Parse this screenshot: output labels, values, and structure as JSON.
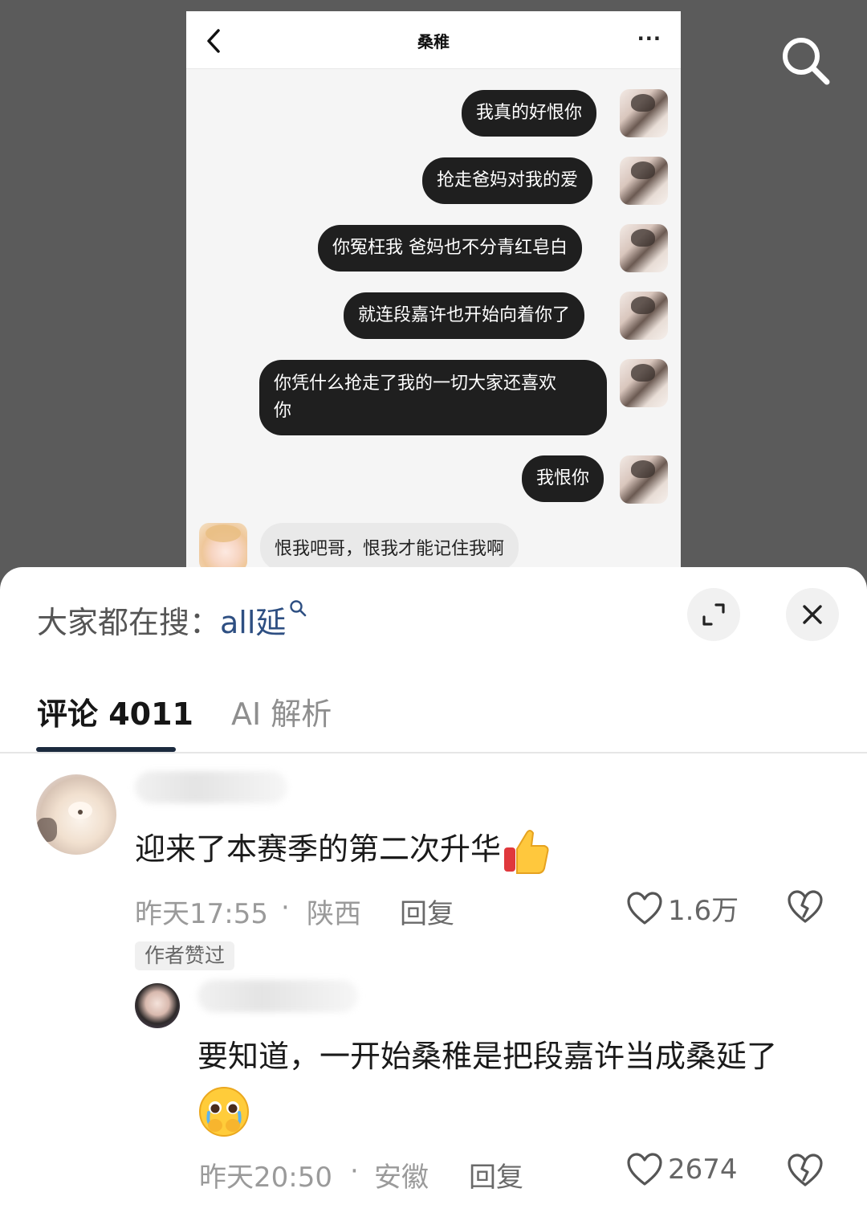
{
  "chat": {
    "title": "桑稚",
    "more": "···",
    "messages_right": [
      "我真的好恨你",
      "抢走爸妈对我的爱",
      "你冤枉我 爸妈也不分青红皂白",
      "就连段嘉许也开始向着你了",
      "你凭什么抢走了我的一切大家还喜欢",
      "你",
      "我恨你"
    ],
    "message_left": "恨我吧哥，恨我才能记住我啊"
  },
  "hot_search": {
    "prefix": "大家都在搜：",
    "keyword": "all延"
  },
  "tabs": {
    "comments": "评论 4011",
    "ai": "AI 解析"
  },
  "comments": [
    {
      "text": "迎来了本赛季的第二次升华",
      "emoji": "thumbs-up-icon",
      "time": "昨天17:55",
      "location": "陕西",
      "reply": "回复",
      "likes": "1.6万",
      "badge": "作者赞过"
    },
    {
      "text_line1": "要知道，一开始桑稚是把段嘉许当成桑延了",
      "emoji": "pleading-face-icon",
      "time": "昨天20:50",
      "location": "安徽",
      "reply": "回复",
      "likes": "2674"
    }
  ],
  "separator": "·"
}
